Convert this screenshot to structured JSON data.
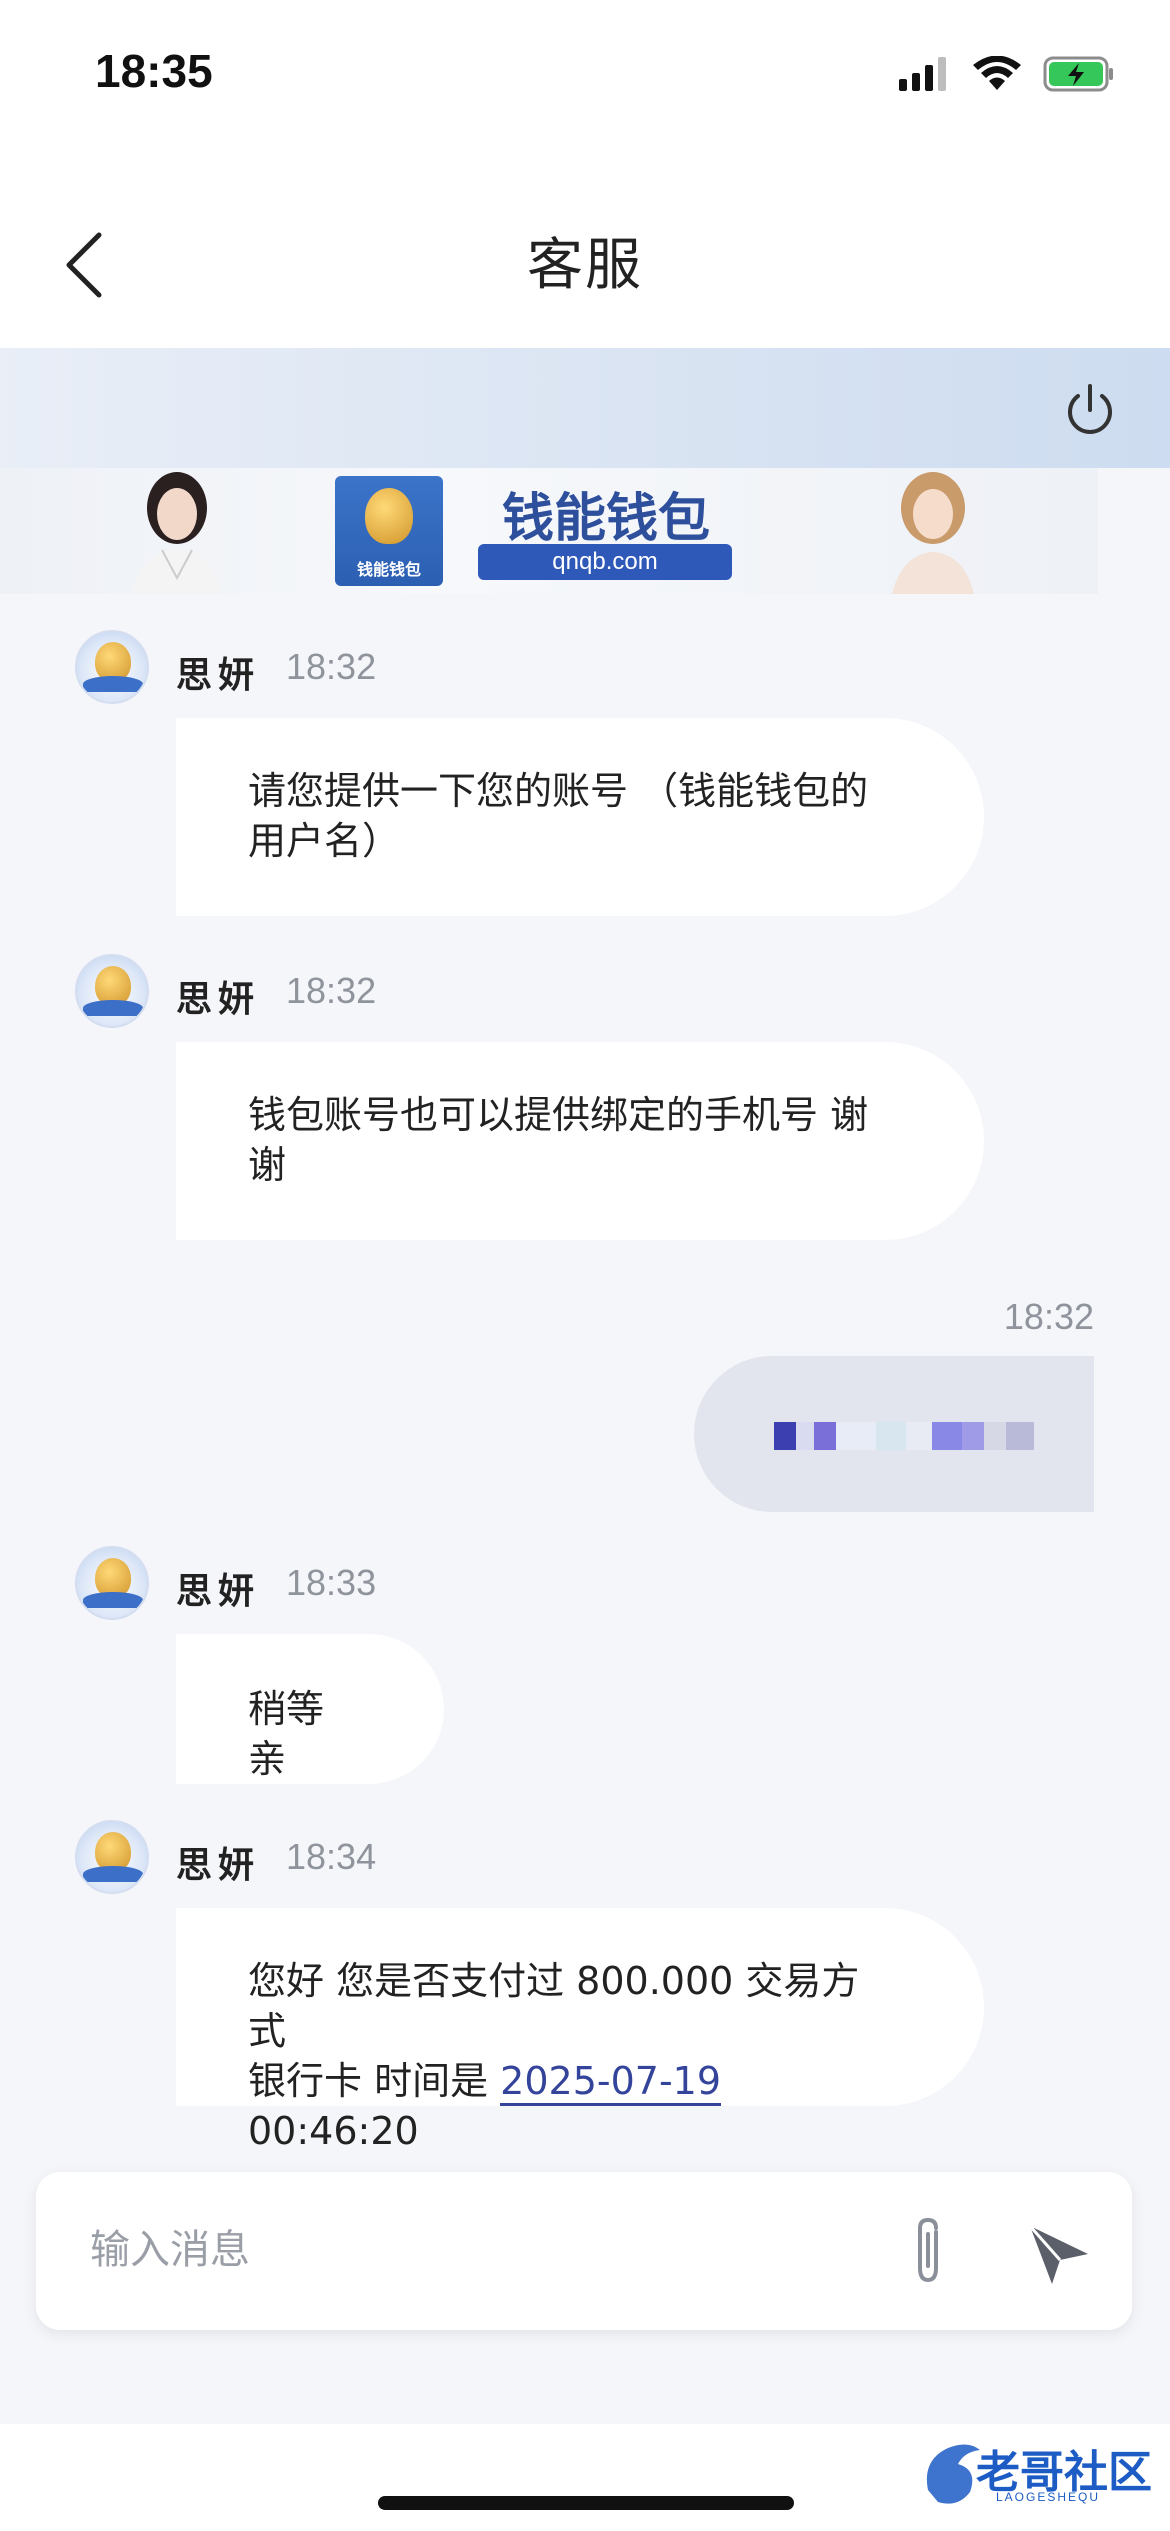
{
  "status_bar": {
    "time": "18:35"
  },
  "nav": {
    "title": "客服"
  },
  "banner": {
    "brand": "钱能钱包",
    "domain": "qnqb.com",
    "logo_text": "钱能钱包"
  },
  "messages": [
    {
      "sender": "思妍",
      "time": "18:32",
      "lines": [
        "请您提供一下您的账号 （钱能钱包的",
        "用户名）"
      ]
    },
    {
      "sender": "思妍",
      "time": "18:32",
      "lines": [
        "钱包账号也可以提供绑定的手机号 谢",
        "谢"
      ]
    },
    {
      "outgoing_time": "18:32"
    },
    {
      "sender": "思妍",
      "time": "18:33",
      "lines": [
        "稍等 亲"
      ]
    },
    {
      "sender": "思妍",
      "time": "18:34",
      "line1": "您好 您是否支付过 800.000 交易方式",
      "line2_prefix": "银行卡 时间是 ",
      "line2_date": "2025-07-19",
      "line2_suffix": " 00:46:20"
    }
  ],
  "input": {
    "placeholder": "输入消息"
  },
  "watermark": {
    "text": "老哥社区",
    "sub": "LAOGESHEQU"
  },
  "icons": {
    "back": "chevron-left-icon",
    "power": "power-icon",
    "attach": "paperclip-icon",
    "send": "send-icon",
    "signal": "cellular-signal-icon",
    "wifi": "wifi-icon",
    "battery": "battery-charging-icon"
  },
  "colors": {
    "accent": "#2f59b8",
    "date_link": "#34449a",
    "battery": "#35c759",
    "outgoing_bubble": "#e3e5ee",
    "incoming_bubble": "#ffffff",
    "background": "#f5f6fa"
  }
}
